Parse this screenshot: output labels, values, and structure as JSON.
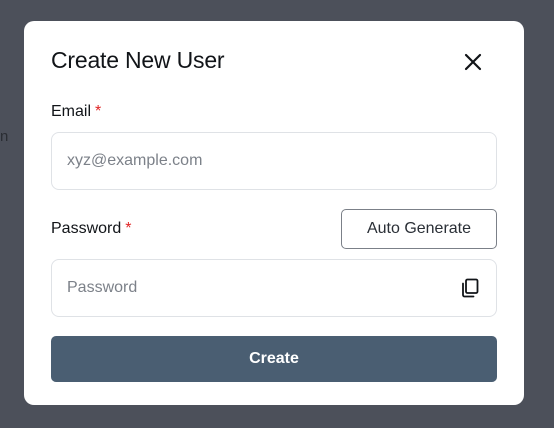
{
  "backdrop": {
    "partial_text": "n"
  },
  "modal": {
    "title": "Create New User",
    "close_icon": "close-icon",
    "email": {
      "label": "Email",
      "required_marker": "*",
      "placeholder": "xyz@example.com",
      "value": ""
    },
    "password": {
      "label": "Password",
      "required_marker": "*",
      "placeholder": "Password",
      "value": "",
      "copy_icon": "copy-icon"
    },
    "auto_generate_label": "Auto Generate",
    "create_label": "Create"
  },
  "colors": {
    "backdrop": "#4c505a",
    "primary_button": "#4a5e72",
    "required": "#e02424"
  }
}
